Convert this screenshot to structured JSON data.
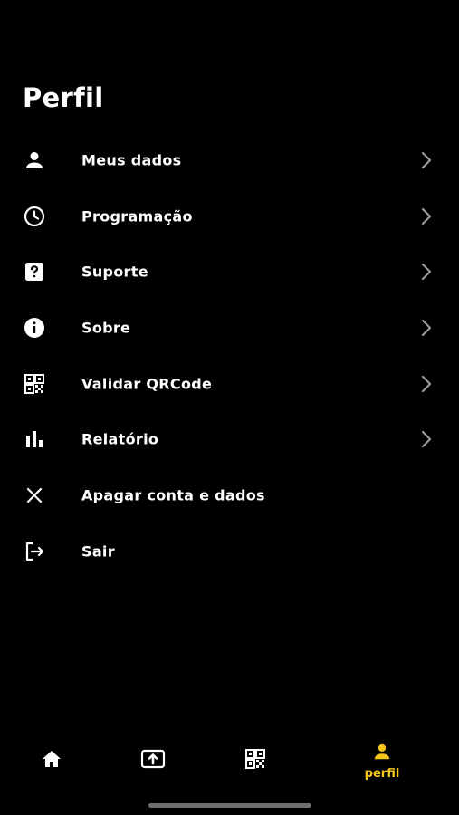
{
  "page": {
    "title": "Perfil"
  },
  "menu": {
    "items": [
      {
        "label": "Meus dados",
        "icon": "person-icon",
        "has_chevron": true
      },
      {
        "label": "Programação",
        "icon": "clock-icon",
        "has_chevron": true
      },
      {
        "label": "Suporte",
        "icon": "help-icon",
        "has_chevron": true
      },
      {
        "label": "Sobre",
        "icon": "info-icon",
        "has_chevron": true
      },
      {
        "label": "Validar QRCode",
        "icon": "qrcode-icon",
        "has_chevron": true
      },
      {
        "label": "Relatório",
        "icon": "bar-chart-icon",
        "has_chevron": true
      },
      {
        "label": "Apagar conta e dados",
        "icon": "close-icon",
        "has_chevron": false
      },
      {
        "label": "Sair",
        "icon": "logout-icon",
        "has_chevron": false
      }
    ]
  },
  "tabbar": {
    "tabs": [
      {
        "icon": "home-icon",
        "label": "",
        "active": false
      },
      {
        "icon": "upload-icon",
        "label": "",
        "active": false
      },
      {
        "icon": "qrcode-icon",
        "label": "",
        "active": false
      },
      {
        "icon": "person-icon",
        "label": "perfil",
        "active": true
      }
    ]
  },
  "colors": {
    "background": "#000000",
    "text": "#ffffff",
    "accent": "#f5c518",
    "chevron": "#9a9a9a"
  }
}
